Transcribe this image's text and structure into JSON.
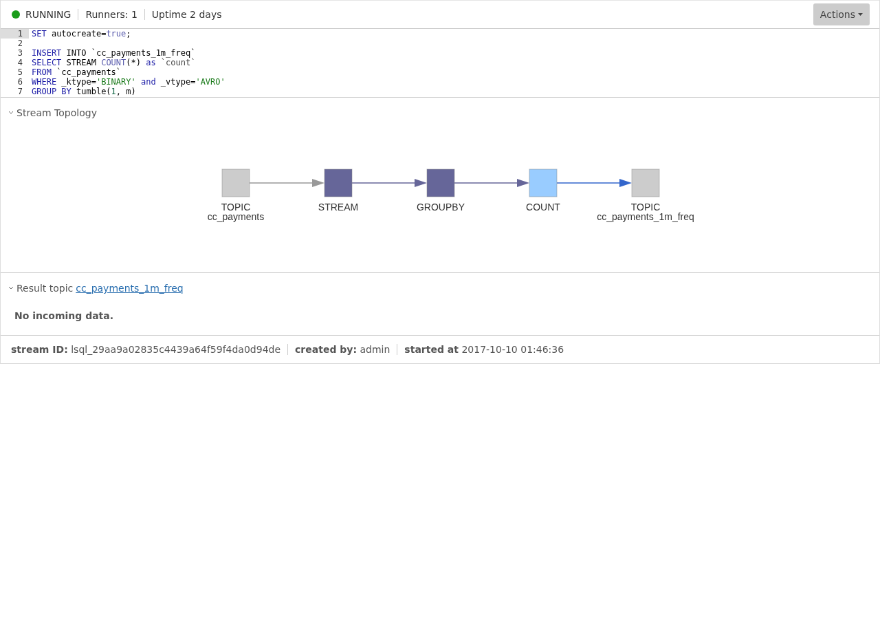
{
  "status": {
    "label": "RUNNING",
    "running": true,
    "color": "#1a9c1a"
  },
  "header_items": [
    "Runners: 1",
    "Uptime 2 days"
  ],
  "actions_button": {
    "label": "Actions"
  },
  "editor": {
    "lines": [
      {
        "number": "1",
        "active": true,
        "tokens": [
          {
            "kind": "keyword",
            "text": "SET"
          },
          {
            "kind": "plain",
            "text": " autocreate="
          },
          {
            "kind": "atom",
            "text": "true"
          },
          {
            "kind": "plain",
            "text": ";"
          }
        ]
      },
      {
        "number": "2",
        "active": false
      },
      {
        "number": "3",
        "active": false,
        "tokens": [
          {
            "kind": "keyword",
            "text": "INSERT"
          },
          {
            "kind": "plain",
            "text": " INTO `cc_payments_1m_freq`"
          }
        ]
      },
      {
        "number": "4",
        "active": false,
        "tokens": [
          {
            "kind": "keyword",
            "text": "SELECT"
          },
          {
            "kind": "plain",
            "text": " STREAM "
          },
          {
            "kind": "builtin",
            "text": "COUNT"
          },
          {
            "kind": "plain",
            "text": "(*) "
          },
          {
            "kind": "keyword",
            "text": "as"
          },
          {
            "kind": "quoted",
            "text": " `count`"
          }
        ]
      },
      {
        "number": "5",
        "active": false,
        "tokens": [
          {
            "kind": "keyword",
            "text": "FROM"
          },
          {
            "kind": "plain",
            "text": " `cc_payments`"
          }
        ]
      },
      {
        "number": "6",
        "active": false,
        "tokens": [
          {
            "kind": "keyword",
            "text": "WHERE"
          },
          {
            "kind": "plain",
            "text": " _ktype="
          },
          {
            "kind": "string",
            "text": "'BINARY'"
          },
          {
            "kind": "keyword",
            "text": " and"
          },
          {
            "kind": "plain",
            "text": " _vtype="
          },
          {
            "kind": "string",
            "text": "'AVRO'"
          }
        ]
      },
      {
        "number": "7",
        "active": false,
        "tokens": [
          {
            "kind": "keyword",
            "text": "GROUP BY"
          },
          {
            "kind": "plain",
            "text": " tumble("
          },
          {
            "kind": "number",
            "text": "1"
          },
          {
            "kind": "plain",
            "text": ", m)"
          }
        ]
      }
    ]
  },
  "topology": {
    "title": "Stream Topology",
    "expanded": true,
    "nodes": [
      {
        "type": "TOPIC",
        "name": "cc_payments",
        "color": "#cccccc"
      },
      {
        "type": "STREAM",
        "color": "#666699"
      },
      {
        "type": "GROUPBY",
        "color": "#666699"
      },
      {
        "type": "COUNT",
        "color": "#99ccff"
      },
      {
        "type": "TOPIC",
        "name": "cc_payments_1m_freq",
        "color": "#cccccc"
      }
    ],
    "edges": [
      {
        "color": "#999999"
      },
      {
        "color": "#666699"
      },
      {
        "color": "#666699"
      },
      {
        "color": "#3366cc"
      }
    ]
  },
  "result": {
    "title": "Result topic",
    "topic": "cc_payments_1m_freq",
    "expanded": true,
    "message": "No incoming data."
  },
  "footer": [
    "**stream ID:** lsql_29aa9a02835c4439a64f59f4da0d94de",
    "**created by:** admin",
    "**started at** 2017-10-10 01:46:36"
  ]
}
